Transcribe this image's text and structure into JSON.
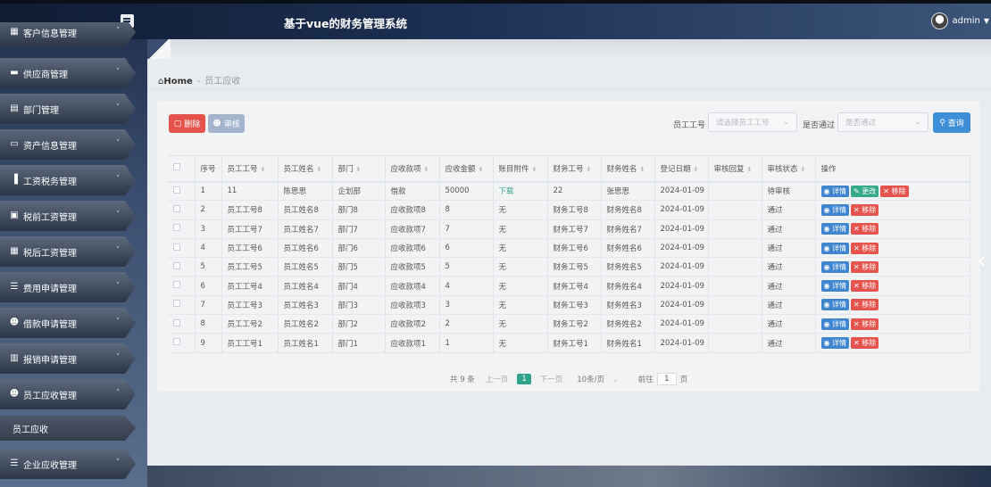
{
  "app": {
    "title": "基于vue的财务管理系统",
    "user": "admin"
  },
  "sidebar": {
    "items": [
      {
        "label": "客户信息管理",
        "icon": "grid-icon"
      },
      {
        "label": "供应商管理",
        "icon": "comment-icon"
      },
      {
        "label": "部门管理",
        "icon": "clipboard-icon"
      },
      {
        "label": "资产信息管理",
        "icon": "monitor-icon"
      },
      {
        "label": "工资税务管理",
        "icon": "bar-chart-icon"
      },
      {
        "label": "税前工资管理",
        "icon": "signpost-icon"
      },
      {
        "label": "税后工资管理",
        "icon": "grid-icon"
      },
      {
        "label": "费用申请管理",
        "icon": "list-icon"
      },
      {
        "label": "借款申请管理",
        "icon": "user-icon"
      },
      {
        "label": "报销申请管理",
        "icon": "book-icon"
      },
      {
        "label": "员工应收管理",
        "icon": "user-icon"
      },
      {
        "label": "员工应收",
        "icon": ""
      },
      {
        "label": "企业应收管理",
        "icon": "list-icon"
      }
    ]
  },
  "breadcrumb": {
    "home": "Home",
    "current": "员工应收"
  },
  "toolbar": {
    "delete_label": "删除",
    "audit_label": "审核",
    "emp_no_label": "员工工号",
    "emp_no_placeholder": "请选择员工工号",
    "passed_label": "是否通过",
    "passed_placeholder": "是否通过",
    "search_label": "查询"
  },
  "table": {
    "headers": [
      "序号",
      "员工工号",
      "员工姓名",
      "部门",
      "应收款项",
      "应收金额",
      "账目附件",
      "财务工号",
      "财务姓名",
      "登记日期",
      "审核回复",
      "审核状态",
      "操作"
    ],
    "rows": [
      [
        "1",
        "11",
        "陈思思",
        "企划部",
        "借款",
        "50000",
        "下载",
        "22",
        "张思思",
        "2024-01-09",
        "",
        "待审核"
      ],
      [
        "2",
        "员工工号8",
        "员工姓名8",
        "部门8",
        "应收款项8",
        "8",
        "无",
        "财务工号8",
        "财务姓名8",
        "2024-01-09",
        "",
        "通过"
      ],
      [
        "3",
        "员工工号7",
        "员工姓名7",
        "部门7",
        "应收款项7",
        "7",
        "无",
        "财务工号7",
        "财务姓名7",
        "2024-01-09",
        "",
        "通过"
      ],
      [
        "4",
        "员工工号6",
        "员工姓名6",
        "部门6",
        "应收款项6",
        "6",
        "无",
        "财务工号6",
        "财务姓名6",
        "2024-01-09",
        "",
        "通过"
      ],
      [
        "5",
        "员工工号5",
        "员工姓名5",
        "部门5",
        "应收款项5",
        "5",
        "无",
        "财务工号5",
        "财务姓名5",
        "2024-01-09",
        "",
        "通过"
      ],
      [
        "6",
        "员工工号4",
        "员工姓名4",
        "部门4",
        "应收款项4",
        "4",
        "无",
        "财务工号4",
        "财务姓名4",
        "2024-01-09",
        "",
        "通过"
      ],
      [
        "7",
        "员工工号3",
        "员工姓名3",
        "部门3",
        "应收款项3",
        "3",
        "无",
        "财务工号3",
        "财务姓名3",
        "2024-01-09",
        "",
        "通过"
      ],
      [
        "8",
        "员工工号2",
        "员工姓名2",
        "部门2",
        "应收款项2",
        "2",
        "无",
        "财务工号2",
        "财务姓名2",
        "2024-01-09",
        "",
        "通过"
      ],
      [
        "9",
        "员工工号1",
        "员工姓名1",
        "部门1",
        "应收款项1",
        "1",
        "无",
        "财务工号1",
        "财务姓名1",
        "2024-01-09",
        "",
        "通过"
      ]
    ],
    "actions": {
      "detail": "详情",
      "edit": "更改",
      "remove": "移除"
    }
  },
  "pager": {
    "total": "共 9 条",
    "prev": "上一页",
    "page": "1",
    "next": "下一页",
    "size": "10条/页",
    "goto_label": "前往",
    "goto_value": "1",
    "page_suffix": "页"
  },
  "colors": {
    "danger": "#e4544c",
    "primary": "#3f8fd8",
    "success": "#36a98a"
  }
}
